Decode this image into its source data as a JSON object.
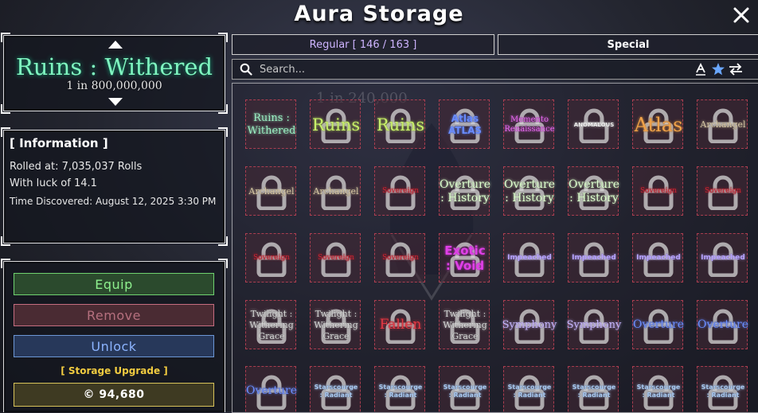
{
  "window": {
    "title": "Aura Storage"
  },
  "selected_aura": {
    "name": "Ruins : Withered",
    "odds": "1 in 800,000,000"
  },
  "information": {
    "heading": "[ Information ]",
    "rolled_at": "Rolled at: 7,035,037 Rolls",
    "luck": "With luck of 14.1",
    "discovered": "Time Discovered: August 12, 2025 3:30 PM"
  },
  "actions": {
    "equip": "Equip",
    "remove": "Remove",
    "unlock": "Unlock",
    "upgrade_label": "[ Storage Upgrade ]",
    "coins": "© 94,680"
  },
  "tabs": {
    "regular": "Regular [ 146 / 163 ]",
    "special": "Special"
  },
  "search": {
    "placeholder": "Search..."
  },
  "background_text": {
    "odds": "1 in 240,000"
  },
  "colors": {
    "accent_purple": "#cdb4ff",
    "equip_green": "#8ef08e",
    "remove_red": "#b5707e",
    "unlock_blue": "#8cb4ff",
    "gold": "#f2cc40"
  },
  "grid": [
    [
      {
        "text": "Ruins :\nWithered",
        "color": "#9ff0c6",
        "font": "serif",
        "size": 13,
        "locked": false
      },
      {
        "text": "Ruins",
        "color": "#c8ef6a",
        "font": "serif",
        "size": 21,
        "locked": true
      },
      {
        "text": "Ruins",
        "color": "#c8ef6a",
        "font": "serif",
        "size": 21,
        "locked": true
      },
      {
        "text": "Atlas\nATLAS",
        "color": "#6a8cff",
        "font": "sans",
        "size": 12,
        "locked": true
      },
      {
        "text": "Memento\nRenaissance",
        "color": "#e86cf0",
        "font": "serif",
        "size": 10,
        "locked": true
      },
      {
        "text": "ANOMALOUS",
        "color": "#f0f0f0",
        "font": "sans",
        "size": 7,
        "locked": true
      },
      {
        "text": "Atlas",
        "color": "#f0a24a",
        "font": "serif",
        "size": 24,
        "locked": true
      },
      {
        "text": "Archangel",
        "color": "#d9c9a8",
        "font": "serif",
        "size": 11,
        "locked": true
      }
    ],
    [
      {
        "text": "Archangel",
        "color": "#d9c9a8",
        "font": "serif",
        "size": 11,
        "locked": true
      },
      {
        "text": "Archangel",
        "color": "#d9c9a8",
        "font": "serif",
        "size": 11,
        "locked": true
      },
      {
        "text": "Sovereign",
        "color": "#d22a3a",
        "font": "serif",
        "size": 9,
        "locked": true
      },
      {
        "text": "Overture\n: History",
        "color": "#dfffd0",
        "font": "serif",
        "size": 14,
        "locked": true
      },
      {
        "text": "Overture\n: History",
        "color": "#dfffd0",
        "font": "serif",
        "size": 14,
        "locked": true
      },
      {
        "text": "Overture\n: History",
        "color": "#dfffd0",
        "font": "serif",
        "size": 14,
        "locked": true
      },
      {
        "text": "Sovereign",
        "color": "#d22a3a",
        "font": "serif",
        "size": 9,
        "locked": true
      },
      {
        "text": "Sovereign",
        "color": "#d22a3a",
        "font": "serif",
        "size": 9,
        "locked": true
      }
    ],
    [
      {
        "text": "Sovereign",
        "color": "#d22a3a",
        "font": "serif",
        "size": 9,
        "locked": true
      },
      {
        "text": "Sovereign",
        "color": "#d22a3a",
        "font": "serif",
        "size": 9,
        "locked": true
      },
      {
        "text": "Sovereign",
        "color": "#d22a3a",
        "font": "serif",
        "size": 9,
        "locked": true
      },
      {
        "text": "Exotic\n: Void",
        "color": "#e040e8",
        "font": "sans",
        "size": 15,
        "locked": true
      },
      {
        "text": "Impeached",
        "color": "#b8a4ff",
        "font": "sans",
        "size": 9,
        "locked": true
      },
      {
        "text": "Impeached",
        "color": "#b8a4ff",
        "font": "sans",
        "size": 9,
        "locked": true
      },
      {
        "text": "Impeached",
        "color": "#b8a4ff",
        "font": "sans",
        "size": 9,
        "locked": true
      },
      {
        "text": "Impeached",
        "color": "#b8a4ff",
        "font": "sans",
        "size": 9,
        "locked": true
      }
    ],
    [
      {
        "text": "Twilight :\nWithering\nGrace",
        "color": "#d8d8d8",
        "font": "serif",
        "size": 11,
        "locked": true
      },
      {
        "text": "Twilight :\nWithering\nGrace",
        "color": "#d8d8d8",
        "font": "serif",
        "size": 11,
        "locked": true
      },
      {
        "text": "Fallen",
        "color": "#e43a46",
        "font": "serif",
        "size": 17,
        "locked": true
      },
      {
        "text": "Twilight :\nWithering\nGrace",
        "color": "#d8d8d8",
        "font": "serif",
        "size": 11,
        "locked": true
      },
      {
        "text": "Symphony",
        "color": "#c9b8ff",
        "font": "serif",
        "size": 13,
        "locked": true
      },
      {
        "text": "Symphony",
        "color": "#c9b8ff",
        "font": "serif",
        "size": 13,
        "locked": true
      },
      {
        "text": "Overture",
        "color": "#6f8fff",
        "font": "serif",
        "size": 14,
        "locked": true
      },
      {
        "text": "Overture",
        "color": "#6f8fff",
        "font": "serif",
        "size": 14,
        "locked": true
      }
    ],
    [
      {
        "text": "Overture",
        "color": "#6f8fff",
        "font": "serif",
        "size": 14,
        "locked": true
      },
      {
        "text": "Starscourge\n: Radiant",
        "color": "#a9c8f0",
        "font": "sans",
        "size": 8,
        "locked": true
      },
      {
        "text": "Starscourge\n: Radiant",
        "color": "#a9c8f0",
        "font": "sans",
        "size": 8,
        "locked": true
      },
      {
        "text": "Starscourge\n: Radiant",
        "color": "#a9c8f0",
        "font": "sans",
        "size": 8,
        "locked": true
      },
      {
        "text": "Starscourge\n: Radiant",
        "color": "#a9c8f0",
        "font": "sans",
        "size": 8,
        "locked": true
      },
      {
        "text": "Starscourge\n: Radiant",
        "color": "#a9c8f0",
        "font": "sans",
        "size": 8,
        "locked": true
      },
      {
        "text": "Starscourge\n: Radiant",
        "color": "#a9c8f0",
        "font": "sans",
        "size": 8,
        "locked": true
      },
      {
        "text": "Starscourge\n: Radiant",
        "color": "#a9c8f0",
        "font": "sans",
        "size": 8,
        "locked": true
      }
    ]
  ]
}
